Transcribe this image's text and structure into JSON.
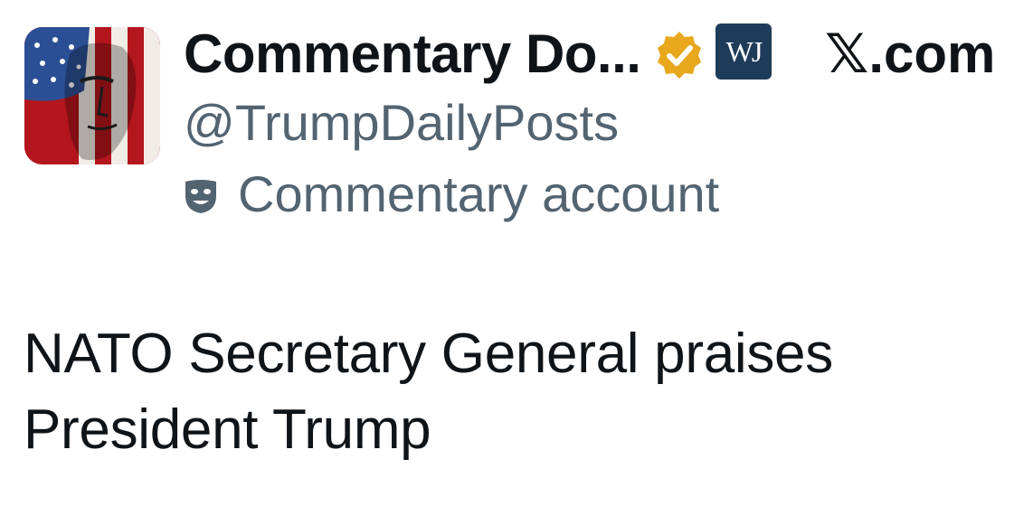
{
  "post": {
    "author": {
      "display_name": "Commentary Do...",
      "handle": "@TrumpDailyPosts",
      "account_label": "Commentary account",
      "affiliate_badge_text": "WJ",
      "verified_color": "#e8a81d",
      "affiliate_color": "#1f3b5a"
    },
    "site": "𝕏.com",
    "text": "NATO Secretary General praises President Trump"
  },
  "icons": {
    "avatar": "flag-portrait-avatar",
    "verified": "gold-verified-badge-icon",
    "affiliate": "affiliate-badge",
    "account_type": "theater-mask-icon"
  },
  "colors": {
    "primary_text": "#0f1419",
    "secondary_text": "#536471"
  }
}
